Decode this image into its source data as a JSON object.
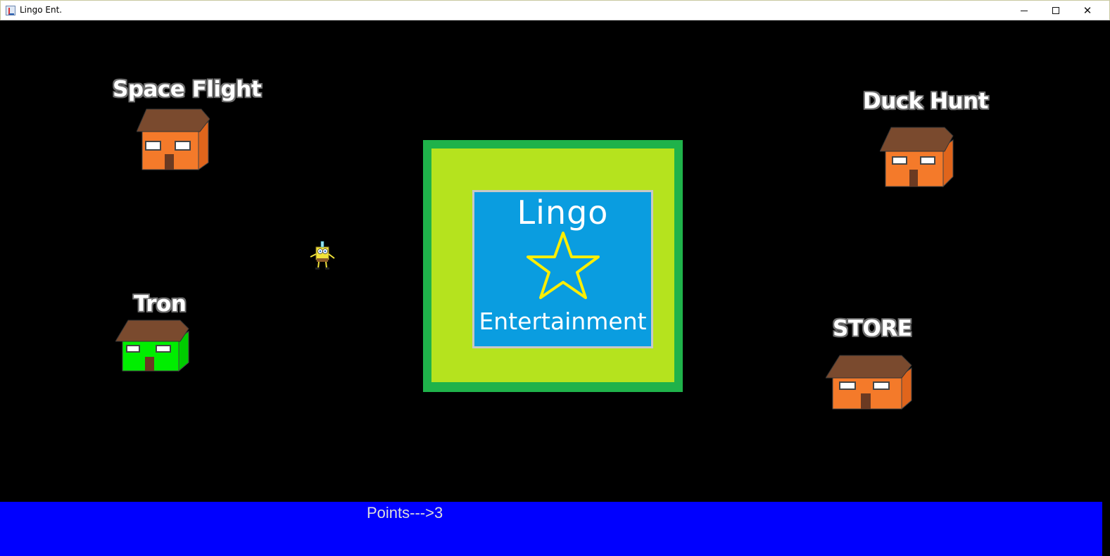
{
  "window": {
    "title": "Lingo Ent.",
    "minimize_glyph": "",
    "maximize_glyph": "",
    "close_glyph": "✕"
  },
  "locations": {
    "space_flight": "Space Flight",
    "duck_hunt": "Duck Hunt",
    "tron": "Tron",
    "store": "STORE"
  },
  "logo": {
    "title": "Lingo",
    "subtitle": "Entertainment"
  },
  "status": {
    "points_text": "Points--->3"
  },
  "colors": {
    "orange_house": "#f47a2a",
    "green_house": "#00ee00",
    "roof": "#7a4a2e",
    "logo_outer": "#1fb24a",
    "logo_mid": "#b5e31e",
    "logo_inner": "#0a9de0",
    "star": "#ffee00",
    "status_bar": "#0000ff"
  },
  "icons": {
    "app_icon": "java-cup-icon",
    "player": "sponge-character-icon"
  }
}
